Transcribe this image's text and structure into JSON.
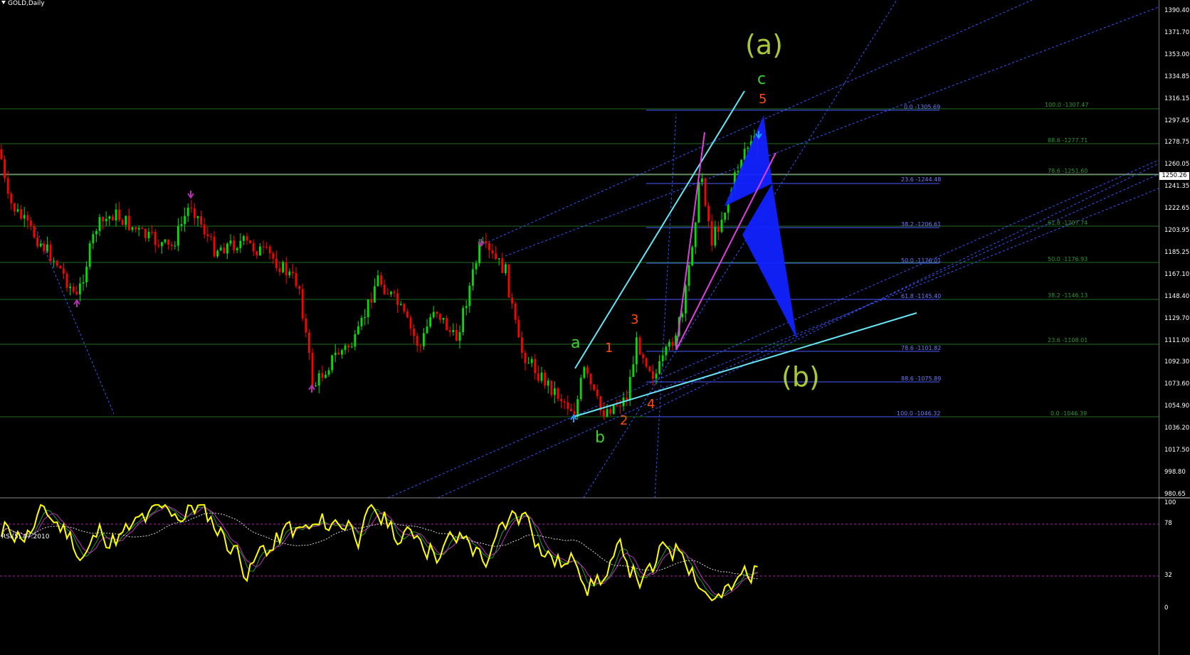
{
  "window": {
    "title": "GOLD,Daily"
  },
  "rsi": {
    "title": "RSI(5) 47.2010",
    "levels": [
      "100",
      "78",
      "32",
      "0"
    ]
  },
  "price_axis": {
    "ticks": [
      "1390.40",
      "1371.70",
      "1353.00",
      "1334.85",
      "1316.15",
      "1297.45",
      "1278.75",
      "1260.05",
      "1241.35",
      "1222.65",
      "1203.95",
      "1185.25",
      "1167.10",
      "1148.40",
      "1129.70",
      "1111.00",
      "1092.30",
      "1073.60",
      "1054.90",
      "1036.20",
      "1017.50",
      "998.80",
      "980.65"
    ],
    "current_price": "1250.26"
  },
  "wave_labels": {
    "a_big": "(a)",
    "b_big": "(b)",
    "a": "a",
    "b": "b",
    "c": "c",
    "n1": "1",
    "n2": "2",
    "n3": "3",
    "n4": "4",
    "n5": "5"
  },
  "fib_blue": [
    "0.0 -1305.69",
    "23.6 -1244.48",
    "38.2 -1206.61",
    "50.0 -1176.01",
    "61.8 -1145.40",
    "78.6 -1101.82",
    "88.6 -1075.89",
    "100.0 -1046.32"
  ],
  "fib_green": [
    "100.0 -1307.47",
    "88.6 -1277.71",
    "78.6 -1251.60",
    "61.8 -1207.74",
    "50.0 -1176.93",
    "38.2 -1146.13",
    "23.6 -1108.01",
    "0.0 -1046.39"
  ],
  "colors": {
    "background": "#000000",
    "bull_candle": "#00e000",
    "bear_candle": "#ff0000",
    "rsi_line": "#ffff00",
    "trend_cyan": "#66e5f5",
    "magenta": "#e040e0",
    "pattern_blue": "#1122ff",
    "grid_green": "#1f6e1f",
    "fib_blue": "#4a5cff",
    "wave_green": "#3ecf2e",
    "wave_orange": "#ff4a10",
    "big_wave": "#a8c83a"
  }
}
